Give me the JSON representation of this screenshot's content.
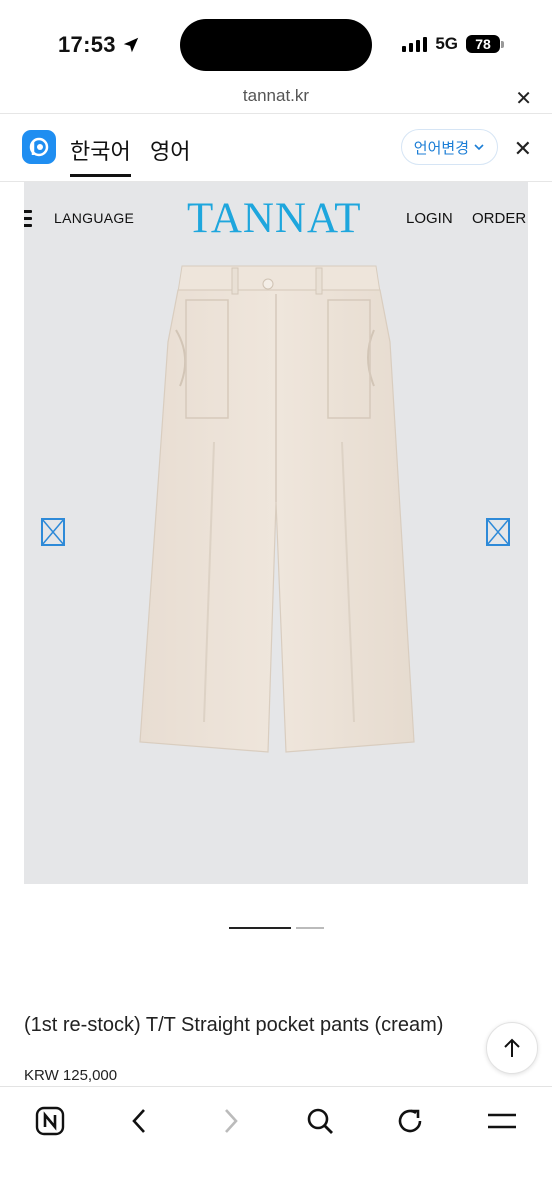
{
  "status_bar": {
    "time": "17:53",
    "network": "5G",
    "battery": "78"
  },
  "browser": {
    "url": "tannat.kr",
    "close_icon": "close-icon"
  },
  "translate_bar": {
    "active_language": "한국어",
    "other_language": "영어",
    "change_language": "언어변경",
    "colors": {
      "accent": "#1c7ed6",
      "logo_bg": "#1f8ef1"
    }
  },
  "site": {
    "nav_language": "LANGUAGE",
    "logo": "TANNAT",
    "login": "LOGIN",
    "order": "ORDER",
    "colors": {
      "logo": "#1ea6dd"
    }
  },
  "product": {
    "title": "(1st re-stock) T/T Straight pocket pants (cream)",
    "price": "KRW 125,000",
    "image_alt": "cream straight pocket pants",
    "slide_count": 2,
    "active_slide": 1
  },
  "toolbar": {
    "items": [
      "naver-home-icon",
      "back-icon",
      "forward-icon",
      "search-icon",
      "reload-icon",
      "menu-icon"
    ]
  }
}
